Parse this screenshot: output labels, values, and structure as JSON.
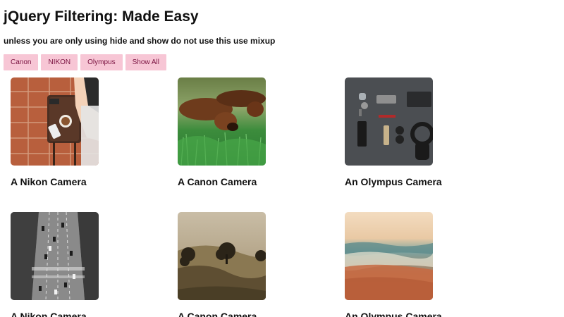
{
  "page": {
    "title": "jQuery Filtering: Made Easy",
    "subtitle": "unless you are only using hide and show do not use this use mixup"
  },
  "filters": [
    {
      "label": "Canon"
    },
    {
      "label": "NIKON"
    },
    {
      "label": "Olympus"
    },
    {
      "label": "Show All"
    }
  ],
  "colors": {
    "button_bg": "#f7c6d5",
    "button_text": "#7a1240"
  },
  "gallery": {
    "items": [
      {
        "title": "A Nikon Camera"
      },
      {
        "title": "A Canon Camera"
      },
      {
        "title": "An Olympus Camera"
      },
      {
        "title": "A Nikon Camera"
      },
      {
        "title": "A Canon Camera"
      },
      {
        "title": "An Olympus Camera"
      }
    ]
  }
}
